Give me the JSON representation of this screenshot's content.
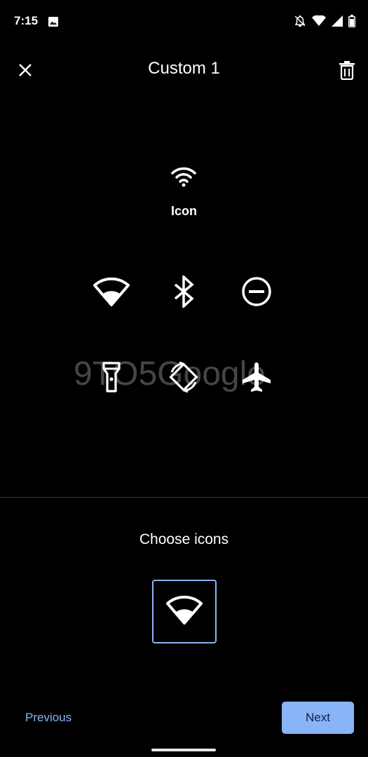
{
  "status_bar": {
    "time": "7:15",
    "icons": [
      "image-icon",
      "bell-off-icon",
      "wifi-icon",
      "signal-icon",
      "battery-icon"
    ]
  },
  "header": {
    "title": "Custom 1",
    "close_icon": "close-icon",
    "delete_icon": "delete-icon"
  },
  "preview": {
    "icon": "wifi-icon",
    "label": "Icon"
  },
  "icon_options": [
    "wifi-wedge-icon",
    "bluetooth-icon",
    "do-not-disturb-icon",
    "flashlight-icon",
    "auto-rotate-icon",
    "airplane-icon"
  ],
  "watermark": "9TO5Google",
  "choose": {
    "label": "Choose icons",
    "selected_icon": "wifi-wedge-icon"
  },
  "footer": {
    "previous_label": "Previous",
    "next_label": "Next"
  },
  "colors": {
    "accent": "#8ab4f8",
    "background": "#000000",
    "next_text": "#0b1f44"
  }
}
